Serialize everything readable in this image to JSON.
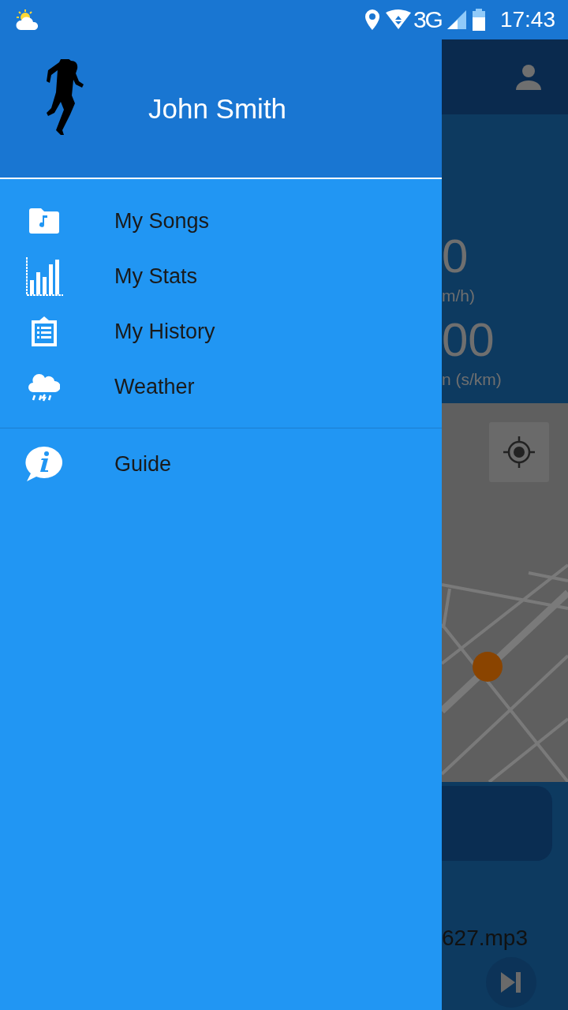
{
  "status_bar": {
    "network": "3G",
    "time": "17:43"
  },
  "drawer": {
    "user_name": "John Smith",
    "sections": [
      {
        "items": [
          {
            "label": "My Songs"
          },
          {
            "label": "My Stats"
          },
          {
            "label": "My History"
          },
          {
            "label": "Weather"
          }
        ]
      },
      {
        "items": [
          {
            "label": "Guide"
          }
        ]
      }
    ]
  },
  "background_screen": {
    "speed_value": "0",
    "speed_unit": "m/h)",
    "pace_value": "00",
    "pace_unit": "n (s/km)",
    "track_name": "627.mp3"
  }
}
